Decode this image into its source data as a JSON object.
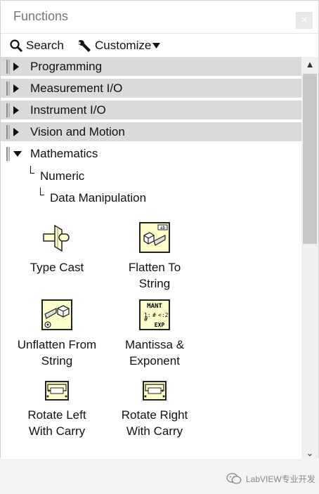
{
  "window": {
    "title": "Functions",
    "close_label": "×"
  },
  "toolbar": {
    "search_label": "Search",
    "customize_label": "Customize"
  },
  "categories": [
    {
      "label": "Programming"
    },
    {
      "label": "Measurement I/O"
    },
    {
      "label": "Instrument I/O"
    },
    {
      "label": "Vision and Motion"
    },
    {
      "label": "Mathematics"
    }
  ],
  "breadcrumb": {
    "level1": "Numeric",
    "level2": "Data Manipulation"
  },
  "items": [
    {
      "line1": "Type Cast",
      "line2": ""
    },
    {
      "line1": "Flatten To",
      "line2": "String"
    },
    {
      "line1": "Unflatten From",
      "line2": "String"
    },
    {
      "line1": "Mantissa &",
      "line2": "Exponent"
    },
    {
      "line1": "Rotate Left",
      "line2": "With Carry"
    },
    {
      "line1": "Rotate Right",
      "line2": "With Carry"
    }
  ],
  "icon_text": {
    "mantissa_top": "MANT",
    "mantissa_exp": "EXP"
  },
  "scroll": {
    "up": "▲",
    "down": "⌄"
  },
  "watermark": {
    "text": "LabVIEW专业开发"
  },
  "colors": {
    "category_bg": "#dadada",
    "icon_bg": "#ffffcc",
    "scrollbar_thumb": "#c8c8c8"
  }
}
